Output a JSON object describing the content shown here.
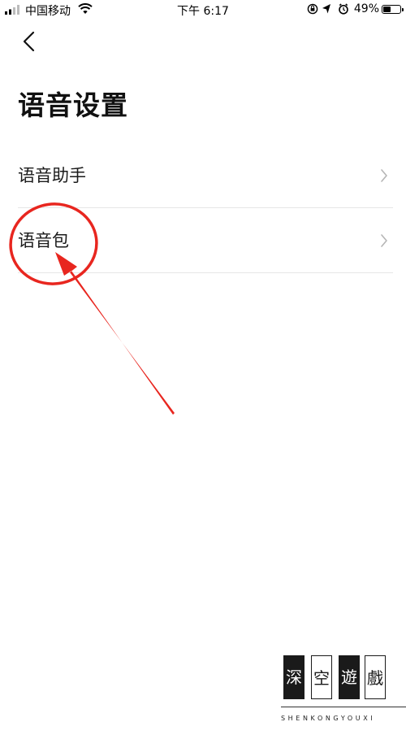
{
  "status_bar": {
    "carrier": "中国移动",
    "time": "下午 6:17",
    "battery": "49%",
    "battery_level": 0.49,
    "icons": [
      "signal-icon",
      "wifi-icon",
      "orientation-lock-icon",
      "location-icon",
      "alarm-icon",
      "battery-icon"
    ]
  },
  "nav": {
    "back_icon": "chevron-left-icon"
  },
  "page": {
    "title": "语音设置"
  },
  "settings": {
    "items": [
      {
        "label": "语音助手",
        "icon": "chevron-right-icon"
      },
      {
        "label": "语音包",
        "icon": "chevron-right-icon"
      }
    ]
  },
  "annotation": {
    "color": "#e8261f",
    "shapes": [
      "circle",
      "arrow"
    ]
  },
  "watermark": {
    "chars": [
      "深",
      "空",
      "遊",
      "戲"
    ],
    "text": "SHENKONGYOUXI"
  }
}
